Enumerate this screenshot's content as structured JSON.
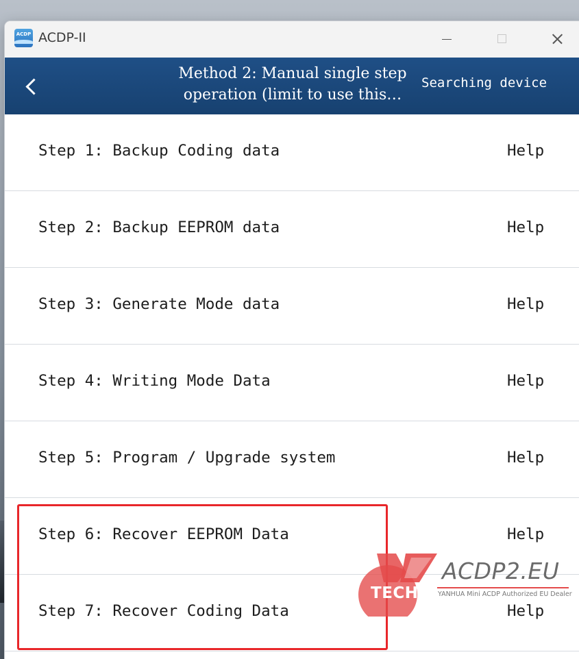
{
  "window": {
    "title": "ACDP-II",
    "icon_text": "ACDP"
  },
  "header": {
    "title_line1": "Method 2: Manual single step",
    "title_line2": "operation   (limit to use this…",
    "status": "Searching device"
  },
  "steps": [
    {
      "label": "Step 1: Backup Coding data",
      "help": "Help"
    },
    {
      "label": "Step 2: Backup EEPROM data",
      "help": "Help"
    },
    {
      "label": "Step 3: Generate Mode data",
      "help": "Help"
    },
    {
      "label": "Step 4: Writing Mode Data",
      "help": "Help"
    },
    {
      "label": "Step 5: Program / Upgrade system",
      "help": "Help"
    },
    {
      "label": "Step 6: Recover EEPROM Data",
      "help": "Help"
    },
    {
      "label": "Step 7: Recover Coding Data",
      "help": "Help"
    }
  ],
  "watermark": {
    "brand": "TECH",
    "site": "ACDP2.EU",
    "tagline": "YANHUA Mini ACDP Authorized EU Dealer"
  },
  "colors": {
    "header_bg": "#1f4f86",
    "highlight": "#e8262a",
    "watermark_red": "#e44a4a"
  }
}
